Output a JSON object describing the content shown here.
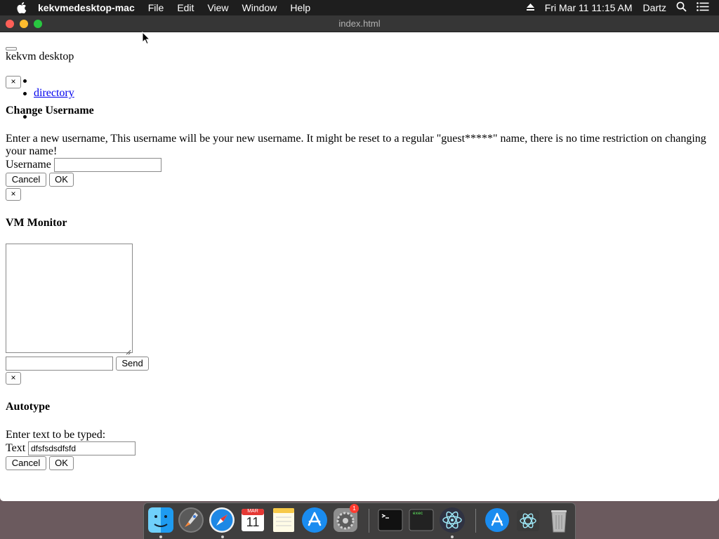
{
  "menubar": {
    "app_name": "kekvmedesktop-mac",
    "menus": [
      "File",
      "Edit",
      "View",
      "Window",
      "Help"
    ],
    "clock": "Fri Mar 11  11:15 AM",
    "user": "Dartz"
  },
  "window": {
    "title": "index.html"
  },
  "page": {
    "brand": "kekvm desktop",
    "close_label": "×",
    "nav": {
      "directory_link": "directory"
    },
    "change_username": {
      "heading": "Change Username",
      "description": "Enter a new username, This username will be your new username. It might be reset to a regular \"guest*****\" name, there is no time restriction on changing your name!",
      "field_label": "Username",
      "field_value": "",
      "cancel_label": "Cancel",
      "ok_label": "OK"
    },
    "vm_monitor": {
      "heading": "VM Monitor",
      "textarea_value": "",
      "input_value": "",
      "send_label": "Send"
    },
    "autotype": {
      "heading": "Autotype",
      "instruction": "Enter text to be typed:",
      "field_label": "Text",
      "field_value": "dfsfsdsdfsfd",
      "cancel_label": "Cancel",
      "ok_label": "OK"
    }
  },
  "dock": {
    "apps": [
      "finder-icon",
      "launchpad-icon",
      "safari-icon",
      "calendar-icon",
      "notes-icon",
      "app-store-icon",
      "system-preferences-icon",
      "terminal-icon",
      "exec-console-icon",
      "electron-icon",
      "app-store-download-icon",
      "electron-app-icon",
      "trash-icon"
    ],
    "calendar_month": "MAR",
    "calendar_day": "11",
    "sys_prefs_badge": "1",
    "exec_label": "exec"
  }
}
